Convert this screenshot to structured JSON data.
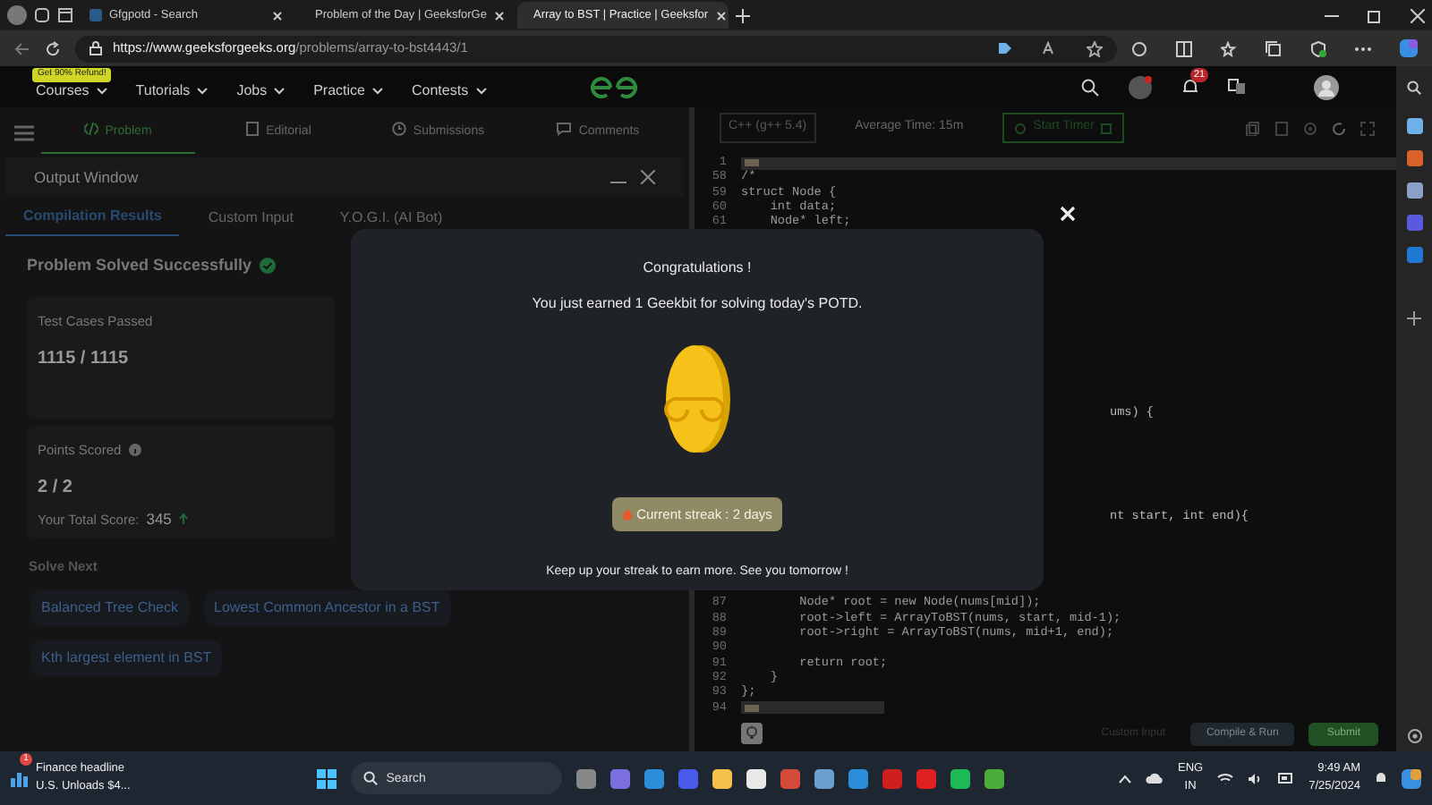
{
  "browser": {
    "tabs": [
      {
        "title": "Gfgpotd - Search",
        "selected": false
      },
      {
        "title": "Problem of the Day | GeeksforGe",
        "selected": false
      },
      {
        "title": "Array to BST | Practice | Geeksfor",
        "selected": true
      }
    ],
    "url_host": "https://www.geeksforgeeks.org",
    "url_path": "/problems/array-to-bst4443/1"
  },
  "site_nav": {
    "promo_badge": "Get 90% Refund!",
    "menu": [
      "Courses",
      "Tutorials",
      "Jobs",
      "Practice",
      "Contests"
    ],
    "notification_count": "21"
  },
  "problem_tabs": [
    {
      "label": "Problem",
      "selected": true
    },
    {
      "label": "Editorial",
      "selected": false
    },
    {
      "label": "Submissions",
      "selected": false
    },
    {
      "label": "Comments",
      "selected": false
    }
  ],
  "output_window": {
    "title": "Output Window",
    "tabs": [
      {
        "label": "Compilation Results",
        "selected": true
      },
      {
        "label": "Custom Input",
        "selected": false
      },
      {
        "label": "Y.O.G.I. (AI Bot)",
        "selected": false
      }
    ],
    "status": "Problem Solved Successfully",
    "test_cases": {
      "label": "Test Cases Passed",
      "value": "1115 / 1115"
    },
    "points": {
      "label": "Points Scored",
      "value": "2 / 2",
      "total_label": "Your Total Score:",
      "total_value": "345"
    },
    "solve_next": {
      "title": "Solve Next",
      "problems": [
        "Balanced Tree Check",
        "Lowest Common Ancestor in a BST",
        "Kth largest element in BST"
      ]
    }
  },
  "editor": {
    "language": "C++ (g++ 5.4)",
    "average_time": "Average Time: 15m",
    "timer_button": "Start Timer",
    "lines_top": [
      {
        "number": "1",
        "kind": "folded"
      },
      {
        "number": "58",
        "kind": "code",
        "text": "/*"
      },
      {
        "number": "59",
        "kind": "code",
        "text": "struct Node {"
      },
      {
        "number": "60",
        "kind": "code",
        "text": "    int data;"
      },
      {
        "number": "61",
        "kind": "code",
        "text": "    Node* left;"
      }
    ],
    "fragments": [
      "ums) {",
      "nt start, int end){"
    ],
    "lines_bottom": [
      {
        "number": "87",
        "kind": "code",
        "text": "        Node* root = new Node(nums[mid]);"
      },
      {
        "number": "88",
        "kind": "code",
        "text": "        root->left = ArrayToBST(nums, start, mid-1);"
      },
      {
        "number": "89",
        "kind": "code",
        "text": "        root->right = ArrayToBST(nums, mid+1, end);"
      },
      {
        "number": "90",
        "kind": "code"
      },
      {
        "number": "91",
        "kind": "code",
        "text": "        return root;"
      },
      {
        "number": "92",
        "kind": "code",
        "text": "    }"
      },
      {
        "number": "93",
        "kind": "code",
        "text": "};"
      },
      {
        "number": "94",
        "kind": "folded"
      }
    ],
    "buttons": [
      {
        "label": "Custom Input",
        "kind": "link"
      },
      {
        "label": "Compile & Run",
        "kind": "secondary"
      },
      {
        "label": "Submit",
        "kind": "primary"
      }
    ]
  },
  "dialog": {
    "title": "Congratulations !",
    "message": "You just earned 1 Geekbit for solving today's POTD.",
    "streak": "Current streak : 2 days",
    "footer": "Keep up your streak to earn more. See you tomorrow !"
  },
  "taskbar": {
    "news_title": "Finance headline",
    "news_subtitle": "U.S. Unloads $4...",
    "news_badge": "1",
    "search_placeholder": "Search",
    "language": "ENG",
    "region": "IN",
    "time": "9:49 AM",
    "date": "7/25/2024"
  }
}
